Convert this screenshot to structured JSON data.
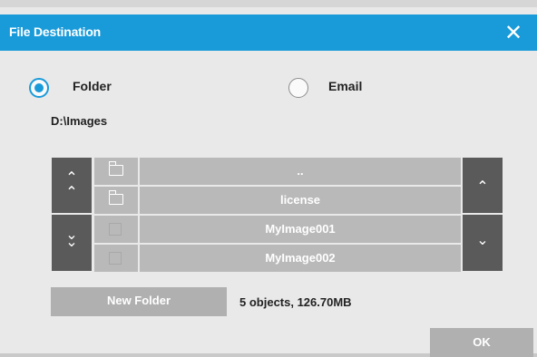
{
  "dialog": {
    "title": "File Destination",
    "close_glyph": "✕"
  },
  "destination": {
    "folder_label": "Folder",
    "email_label": "Email",
    "selected": "Folder"
  },
  "current_path": "D:\\Images",
  "browser": {
    "rows": [
      {
        "name": "..",
        "type": "folder"
      },
      {
        "name": "license",
        "type": "folder"
      },
      {
        "name": "MyImage001",
        "type": "file"
      },
      {
        "name": "MyImage002",
        "type": "file"
      }
    ],
    "page_up_glyph": "⌃",
    "page_down_glyph": "⌄",
    "scroll_up_glyph": "⌃",
    "scroll_down_glyph": "⌄"
  },
  "new_folder_label": "New Folder",
  "status_text": "5 objects, 126.70MB",
  "ok_label": "OK",
  "colors": {
    "accent": "#1a9bd9",
    "nav_bg": "#5a5a5a",
    "row_bg": "#b9b9b9",
    "button_bg": "#b0b0b0"
  }
}
